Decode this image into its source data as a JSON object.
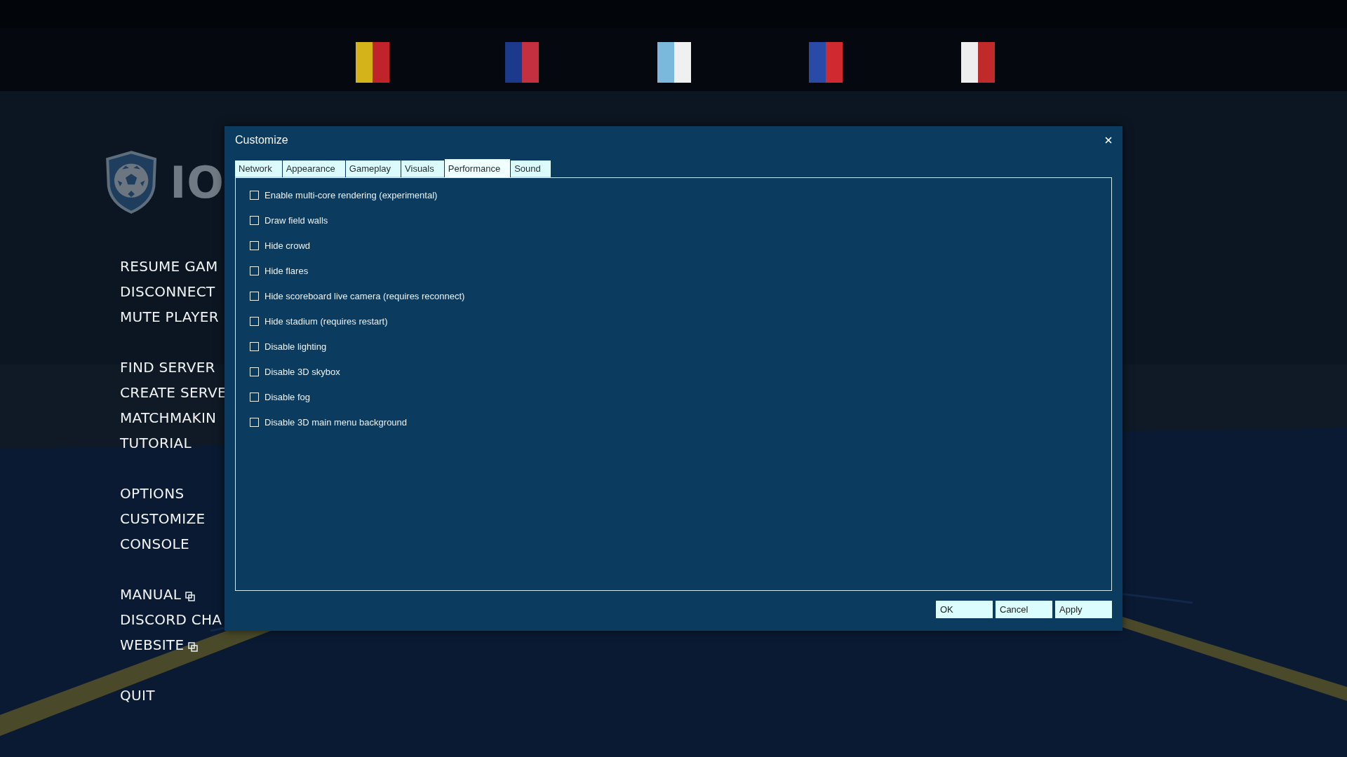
{
  "logo": {
    "text": "IO"
  },
  "menu": [
    {
      "items": [
        {
          "label": "RESUME GAM",
          "external": false
        },
        {
          "label": "DISCONNECT",
          "external": false
        },
        {
          "label": "MUTE PLAYER",
          "external": false
        }
      ]
    },
    {
      "items": [
        {
          "label": "FIND SERVER",
          "external": false
        },
        {
          "label": "CREATE SERVE",
          "external": false
        },
        {
          "label": "MATCHMAKIN",
          "external": false
        },
        {
          "label": "TUTORIAL",
          "external": false
        }
      ]
    },
    {
      "items": [
        {
          "label": "OPTIONS",
          "external": false
        },
        {
          "label": "CUSTOMIZE",
          "external": false
        },
        {
          "label": "CONSOLE",
          "external": false
        }
      ]
    },
    {
      "items": [
        {
          "label": "MANUAL",
          "external": true
        },
        {
          "label": "DISCORD CHA",
          "external": false
        },
        {
          "label": "WEBSITE",
          "external": true
        }
      ]
    },
    {
      "items": [
        {
          "label": "QUIT",
          "external": false
        }
      ]
    }
  ],
  "dialog": {
    "title": "Customize",
    "tabs": [
      {
        "label": "Network",
        "selected": false
      },
      {
        "label": "Appearance",
        "selected": false
      },
      {
        "label": "Gameplay",
        "selected": false
      },
      {
        "label": "Visuals",
        "selected": false
      },
      {
        "label": "Performance",
        "selected": true
      },
      {
        "label": "Sound",
        "selected": false
      }
    ],
    "options": [
      {
        "label": "Enable multi-core rendering (experimental)",
        "checked": false
      },
      {
        "label": "Draw field walls",
        "checked": false
      },
      {
        "label": "Hide crowd",
        "checked": false
      },
      {
        "label": "Hide flares",
        "checked": false
      },
      {
        "label": "Hide scoreboard live camera (requires reconnect)",
        "checked": false
      },
      {
        "label": "Hide stadium (requires restart)",
        "checked": false
      },
      {
        "label": "Disable lighting",
        "checked": false
      },
      {
        "label": "Disable 3D skybox",
        "checked": false
      },
      {
        "label": "Disable fog",
        "checked": false
      },
      {
        "label": "Disable 3D main menu background",
        "checked": false
      }
    ],
    "buttons": [
      "OK",
      "Cancel",
      "Apply"
    ]
  }
}
